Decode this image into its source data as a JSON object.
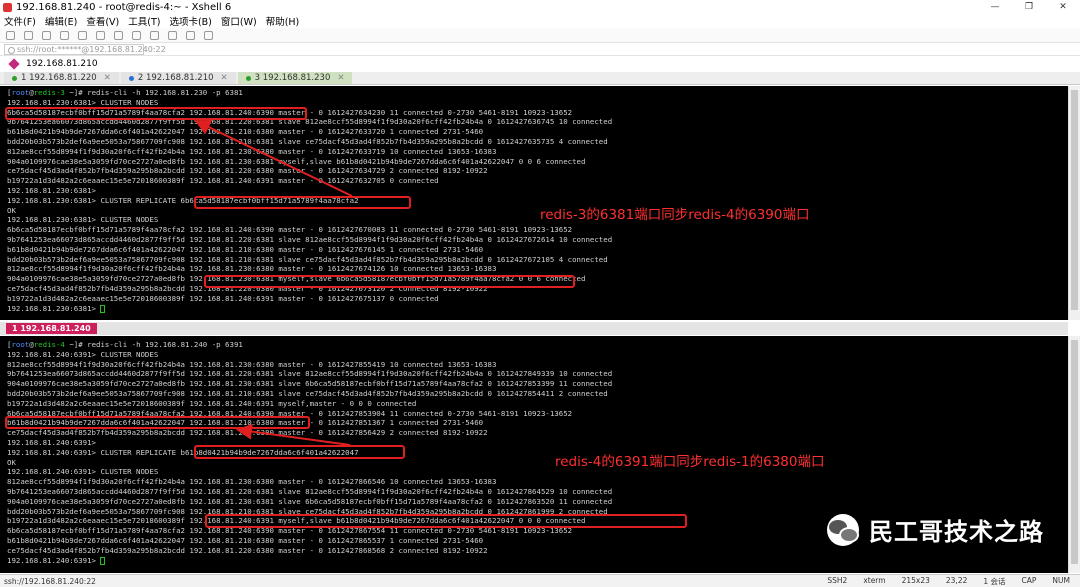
{
  "window": {
    "title": "192.168.81.240 - root@redis-4:~ - Xshell 6",
    "controls": [
      "—",
      "❐",
      "✕"
    ]
  },
  "menu": [
    "文件(F)",
    "编辑(E)",
    "查看(V)",
    "工具(T)",
    "选项卡(B)",
    "窗口(W)",
    "帮助(H)"
  ],
  "address": {
    "placeholder": "ssh://root:******@192.168.81.240:22"
  },
  "session_bar": {
    "label": "192.168.81.210"
  },
  "tabs": [
    {
      "label": "1 192.168.81.220",
      "color": "#2d9e2d"
    },
    {
      "label": "2 192.168.81.210",
      "color": "#2d6fd6"
    },
    {
      "label": "3 192.168.81.230",
      "color": "#2d9e2d",
      "active": true
    }
  ],
  "bottom_pane_tab": "1 192.168.81.240",
  "top_terminal": [
    "[root@redis-3 ~]# redis-cli -h 192.168.81.230 -p 6381",
    "192.168.81.230:6381> CLUSTER NODES",
    "6b6ca5d58187ecbf0bff15d71a5789f4aa78cfa2 192.168.81.240:6390 master - 0 1612427634230 11 connected 0-2730 5461-8191 10923-13652",
    "9b7641253ea66073d865accdd4460d2877f9ff5d 192.168.81.220:6381 slave 812ae8ccf55d8994f1f9d30a20f6cff42fb24b4a 0 1612427636745 10 connected",
    "b61b8d0421b94b9de7267dda6c6f401a42622047 192.168.81.210:6380 master - 0 1612427633720 1 connected 2731-5460",
    "bdd20b03b573b2def6a9ee5053a75867709fc908 192.168.81.210:6381 slave ce75dacf45d3ad4f852b7fb4d359a295b8a2bcdd 0 1612427635735 4 connected",
    "812ae8ccf55d8994f1f9d30a20f6cff42fb24b4a 192.168.81.230:6380 master - 0 1612427633719 10 connected 13653-16383",
    "904a0109976cae38e5a3059fd70ce2727a0ed8fb 192.168.81.230:6381 myself,slave b61b8d0421b94b9de7267dda6c6f401a42622047 0 0 6 connected",
    "ce75dacf45d3ad4f852b7fb4d359a295b8a2bcdd 192.168.81.220:6380 master - 0 1612427634729 2 connected 8192-10922",
    "b19722a1d3d482a2c6eaaec15e5e72018600389f 192.168.81.240:6391 master - 0 1612427632705 0 connected",
    "192.168.81.230:6381>",
    "192.168.81.230:6381> CLUSTER REPLICATE 6b6ca5d58187ecbf0bff15d71a5789f4aa78cfa2",
    "OK",
    "192.168.81.230:6381> CLUSTER NODES",
    "6b6ca5d58187ecbf0bff15d71a5789f4aa78cfa2 192.168.81.240:6390 master - 0 1612427670083 11 connected 0-2730 5461-8191 10923-13652",
    "9b7641253ea66073d865accdd4460d2877f9ff5d 192.168.81.220:6381 slave 812ae8ccf55d8994f1f9d30a20f6cff42fb24b4a 0 1612427672614 10 connected",
    "b61b8d0421b94b9de7267dda6c6f401a42622047 192.168.81.210:6380 master - 0 1612427676145 1 connected 2731-5460",
    "bdd20b03b573b2def6a9ee5053a75867709fc908 192.168.81.210:6381 slave ce75dacf45d3ad4f852b7fb4d359a295b8a2bcdd 0 1612427672105 4 connected",
    "812ae8ccf55d8994f1f9d30a20f6cff42fb24b4a 192.168.81.230:6380 master - 0 1612427674126 10 connected 13653-16383",
    "904a0109976cae38e5a3059fd70ce2727a0ed8fb 192.168.81.230:6381 myself,slave 6b6ca5d58187ecbf0bff15d71a5789f4aa78cfa2 0 0 6 connected",
    "ce75dacf45d3ad4f852b7fb4d359a295b8a2bcdd 192.168.81.220:6380 master - 0 1612427673120 2 connected 8192-10922",
    "b19722a1d3d482a2c6eaaec15e5e72018600389f 192.168.81.240:6391 master - 0 1612427675137 0 connected",
    "192.168.81.230:6381> "
  ],
  "bottom_terminal": [
    "[root@redis-4 ~]# redis-cli -h 192.168.81.240 -p 6391",
    "192.168.81.240:6391> CLUSTER NODES",
    "812ae8ccf55d8994f1f9d30a20f6cff42fb24b4a 192.168.81.230:6380 master - 0 1612427855419 10 connected 13653-16383",
    "9b7641253ea66073d865accdd4460d2877f9ff5d 192.168.81.220:6381 slave 812ae8ccf55d8994f1f9d30a20f6cff42fb24b4a 0 1612427849339 10 connected",
    "904a0109976cae38e5a3059fd70ce2727a0ed8fb 192.168.81.230:6381 slave 6b6ca5d58187ecbf0bff15d71a5789f4aa78cfa2 0 1612427853399 11 connected",
    "bdd20b03b573b2def6a9ee5053a75867709fc908 192.168.81.210:6381 slave ce75dacf45d3ad4f852b7fb4d359a295b8a2bcdd 0 1612427854411 2 connected",
    "b19722a1d3d482a2c6eaaec15e5e72018600389f 192.168.81.240:6391 myself,master - 0 0 0 connected",
    "6b6ca5d58187ecbf0bff15d71a5789f4aa78cfa2 192.168.81.240:6390 master - 0 1612427853904 11 connected 0-2730 5461-8191 10923-13652",
    "b61b8d0421b94b9de7267dda6c6f401a42622047 192.168.81.210:6380 master - 0 1612427851367 1 connected 2731-5460",
    "ce75dacf45d3ad4f852b7fb4d359a295b8a2bcdd 192.168.81.220:6380 master - 0 1612427856429 2 connected 8192-10922",
    "192.168.81.240:6391>",
    "192.168.81.240:6391> CLUSTER REPLICATE b61b8d0421b94b9de7267dda6c6f401a42622047",
    "OK",
    "192.168.81.240:6391> CLUSTER NODES",
    "812ae8ccf55d8994f1f9d30a20f6cff42fb24b4a 192.168.81.230:6380 master - 0 1612427866546 10 connected 13653-16383",
    "9b7641253ea66073d865accdd4460d2877f9ff5d 192.168.81.220:6381 slave 812ae8ccf55d8994f1f9d30a20f6cff42fb24b4a 0 1612427864529 10 connected",
    "904a0109976cae38e5a3059fd70ce2727a0ed8fb 192.168.81.230:6381 slave 6b6ca5d58187ecbf0bff15d71a5789f4aa78cfa2 0 1612427863520 11 connected",
    "bdd20b03b573b2def6a9ee5053a75867709fc908 192.168.81.210:6381 slave ce75dacf45d3ad4f852b7fb4d359a295b8a2bcdd 0 1612427861999 2 connected",
    "b19722a1d3d482a2c6eaaec15e5e72018600389f 192.168.81.240:6391 myself,slave b61b8d0421b94b9de7267dda6c6f401a42622047 0 0 0 connected",
    "6b6ca5d58187ecbf0bff15d71a5789f4aa78cfa2 192.168.81.240:6390 master - 0 1612427867554 11 connected 0-2730 5461-8191 10923-13652",
    "b61b8d0421b94b9de7267dda6c6f401a42622047 192.168.81.210:6380 master - 0 1612427865537 1 connected 2731-5460",
    "ce75dacf45d3ad4f852b7fb4d359a295b8a2bcdd 192.168.81.220:6380 master - 0 1612427868568 2 connected 8192-10922",
    "192.168.81.240:6391> "
  ],
  "annotations": {
    "top": "redis-3的6381端口同步redis-4的6390端口",
    "bottom": "redis-4的6391端口同步redis-1的6380端口"
  },
  "watermark": {
    "text": "民工哥技术之路"
  },
  "status": {
    "left": "ssh://192.168.81.240:22",
    "right": [
      "SSH2",
      "xterm",
      "215x23",
      "23,22",
      "1 会话",
      "CAP",
      "NUM"
    ]
  }
}
